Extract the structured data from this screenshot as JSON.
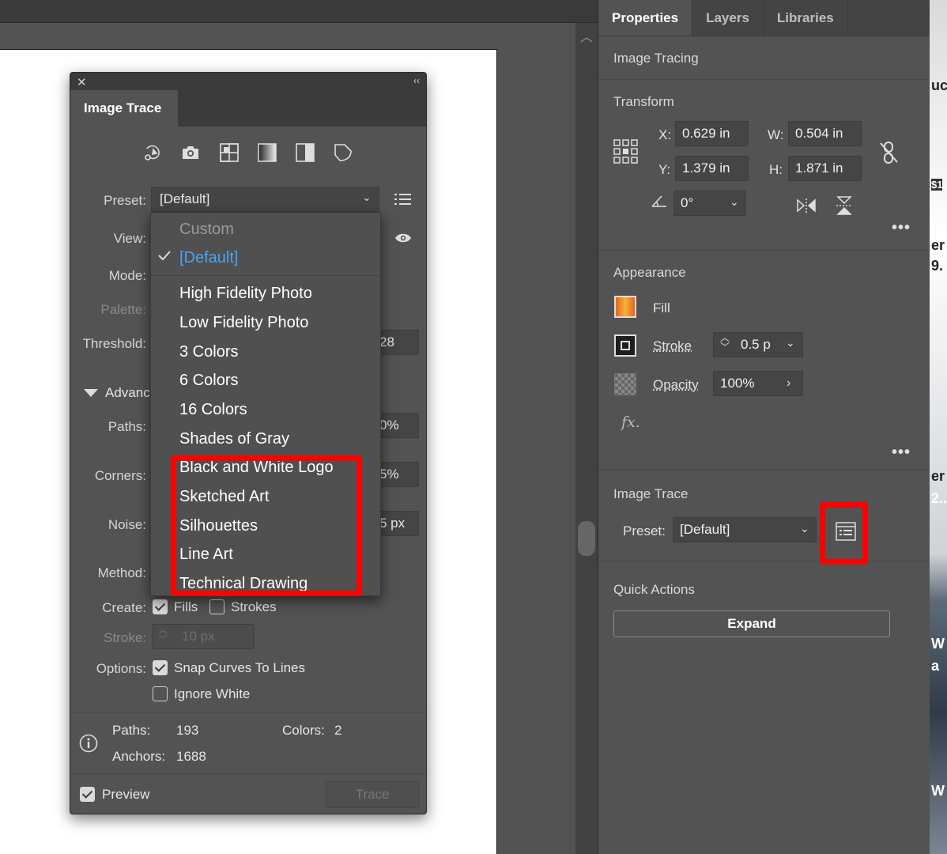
{
  "properties_panel": {
    "tabs": [
      "Properties",
      "Layers",
      "Libraries"
    ],
    "active_tab": "Properties",
    "object_type": "Image Tracing",
    "transform": {
      "title": "Transform",
      "x_label": "X:",
      "x": "0.629 in",
      "y_label": "Y:",
      "y": "1.379 in",
      "w_label": "W:",
      "w": "0.504 in",
      "h_label": "H:",
      "h": "1.871 in",
      "angle": "0°"
    },
    "appearance": {
      "title": "Appearance",
      "fill_label": "Fill",
      "stroke_label": "Stroke",
      "stroke_value": "0.5 p",
      "opacity_label": "Opacity",
      "opacity_value": "100%",
      "fx_label": "fx."
    },
    "image_trace": {
      "title": "Image Trace",
      "preset_label": "Preset:",
      "preset_value": "[Default]"
    },
    "quick_actions": {
      "title": "Quick Actions",
      "expand_label": "Expand"
    }
  },
  "dialog": {
    "tab_title": "Image Trace",
    "preset_label": "Preset:",
    "preset_value": "[Default]",
    "view_label": "View:",
    "mode_label": "Mode:",
    "palette_label": "Palette:",
    "threshold_label": "Threshold:",
    "threshold_value": "28",
    "advanced_label": "Advanc",
    "paths_label": "Paths:",
    "paths_value": "0%",
    "corners_label": "Corners:",
    "corners_value": "5%",
    "noise_label": "Noise:",
    "noise_value": "5 px",
    "method_label": "Method:",
    "create_label": "Create:",
    "fills_label": "Fills",
    "strokes_label": "Strokes",
    "stroke_label": "Stroke:",
    "stroke_value": "10 px",
    "options_label": "Options:",
    "snap_label": "Snap Curves To Lines",
    "ignore_white_label": "Ignore White",
    "stats": {
      "paths_label": "Paths:",
      "paths": "193",
      "colors_label": "Colors:",
      "colors": "2",
      "anchors_label": "Anchors:",
      "anchors": "1688"
    },
    "preview_label": "Preview",
    "trace_label": "Trace",
    "checkboxes": {
      "fills": true,
      "strokes": false,
      "snap": true,
      "ignore_white": false,
      "preview": true
    }
  },
  "preset_menu": {
    "items": [
      "Custom",
      "[Default]",
      "High Fidelity Photo",
      "Low Fidelity Photo",
      "3 Colors",
      "6 Colors",
      "16 Colors",
      "Shades of Gray",
      "Black and White Logo",
      "Sketched Art",
      "Silhouettes",
      "Line Art",
      "Technical Drawing"
    ],
    "selected": "[Default]",
    "disabled": "Custom"
  },
  "strip_text": [
    "uc",
    "$1",
    "er",
    "9.",
    "er",
    "2..",
    "W",
    "a",
    "W"
  ],
  "colors": {
    "panel": "#535353",
    "highlight": "#ff0000",
    "selected": "#4aa3f5"
  }
}
